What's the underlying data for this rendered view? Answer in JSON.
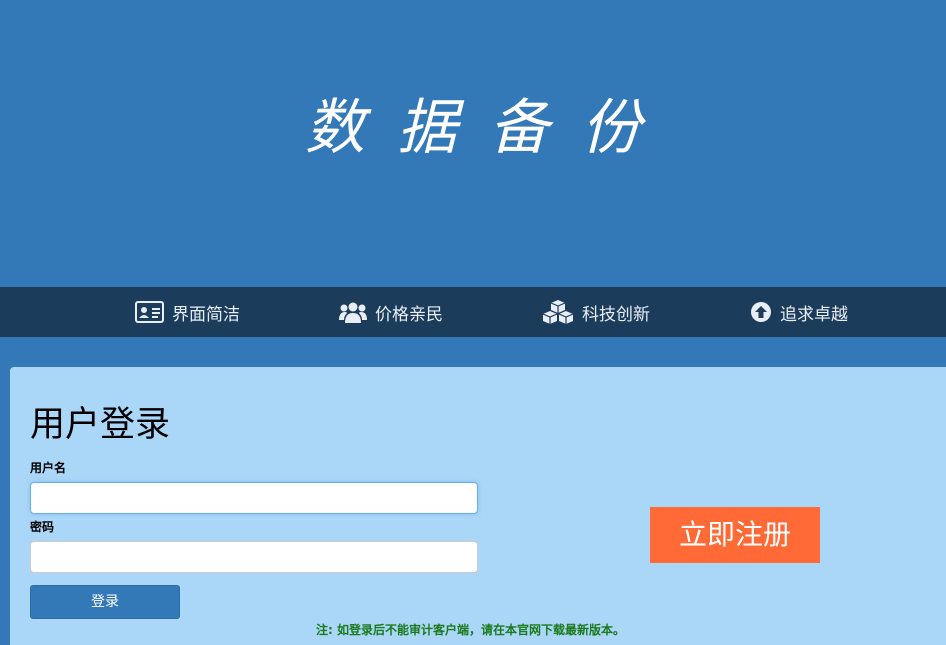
{
  "hero": {
    "title": "数据备份"
  },
  "features": [
    {
      "icon": "id-card-icon",
      "label": "界面简洁"
    },
    {
      "icon": "users-icon",
      "label": "价格亲民"
    },
    {
      "icon": "cubes-icon",
      "label": "科技创新"
    },
    {
      "icon": "arrow-circle-up-icon",
      "label": "追求卓越"
    }
  ],
  "login": {
    "title": "用户登录",
    "username_label": "用户名",
    "username_value": "",
    "password_label": "密码",
    "password_value": "",
    "submit_label": "登录"
  },
  "register": {
    "label": "立即注册"
  },
  "notice": "注: 如登录后不能审计客户端，请在本官网下载最新版本。",
  "colors": {
    "primary": "#3379b7",
    "nav_bar": "#1c3c5c",
    "panel": "#aad6f8",
    "register": "#ff6a36",
    "notice": "#1b7a1b"
  }
}
